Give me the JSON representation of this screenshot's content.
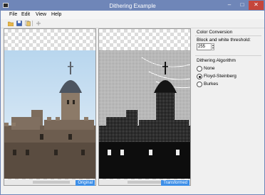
{
  "window": {
    "title": "Dithering Example"
  },
  "menu": {
    "file": "File",
    "edit": "Edit",
    "view": "View",
    "help": "Help"
  },
  "panes": {
    "left_label": "Original",
    "right_label": "Transformed"
  },
  "sidebar": {
    "color_conversion": {
      "title": "Color Conversion",
      "threshold_label": "Block and white threshold:",
      "threshold_value": "255"
    },
    "dithering": {
      "title": "Dithering Algorithm",
      "options": [
        "None",
        "Floyd-Steinberg",
        "Burkes"
      ],
      "selected": "Floyd-Steinberg"
    }
  },
  "colors": {
    "titlebar": "#6f86b8",
    "close": "#c5463c",
    "accent": "#3d8fe8"
  }
}
